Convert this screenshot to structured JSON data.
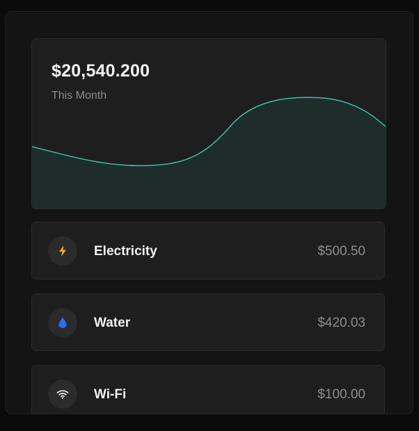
{
  "summary": {
    "amount": "$20,540.200",
    "period": "This Month",
    "accent_color": "#3ebfa5",
    "fill_color": "#1e2d2a"
  },
  "bills": [
    {
      "name": "Electricity",
      "amount": "$500.50",
      "icon": "lightning-icon",
      "icon_color": "#f5a623"
    },
    {
      "name": "Water",
      "amount": "$420.03",
      "icon": "water-drop-icon",
      "icon_color": "#2f6bff"
    },
    {
      "name": "Wi-Fi",
      "amount": "$100.00",
      "icon": "wifi-icon",
      "icon_color": "#e6e6e6"
    }
  ]
}
